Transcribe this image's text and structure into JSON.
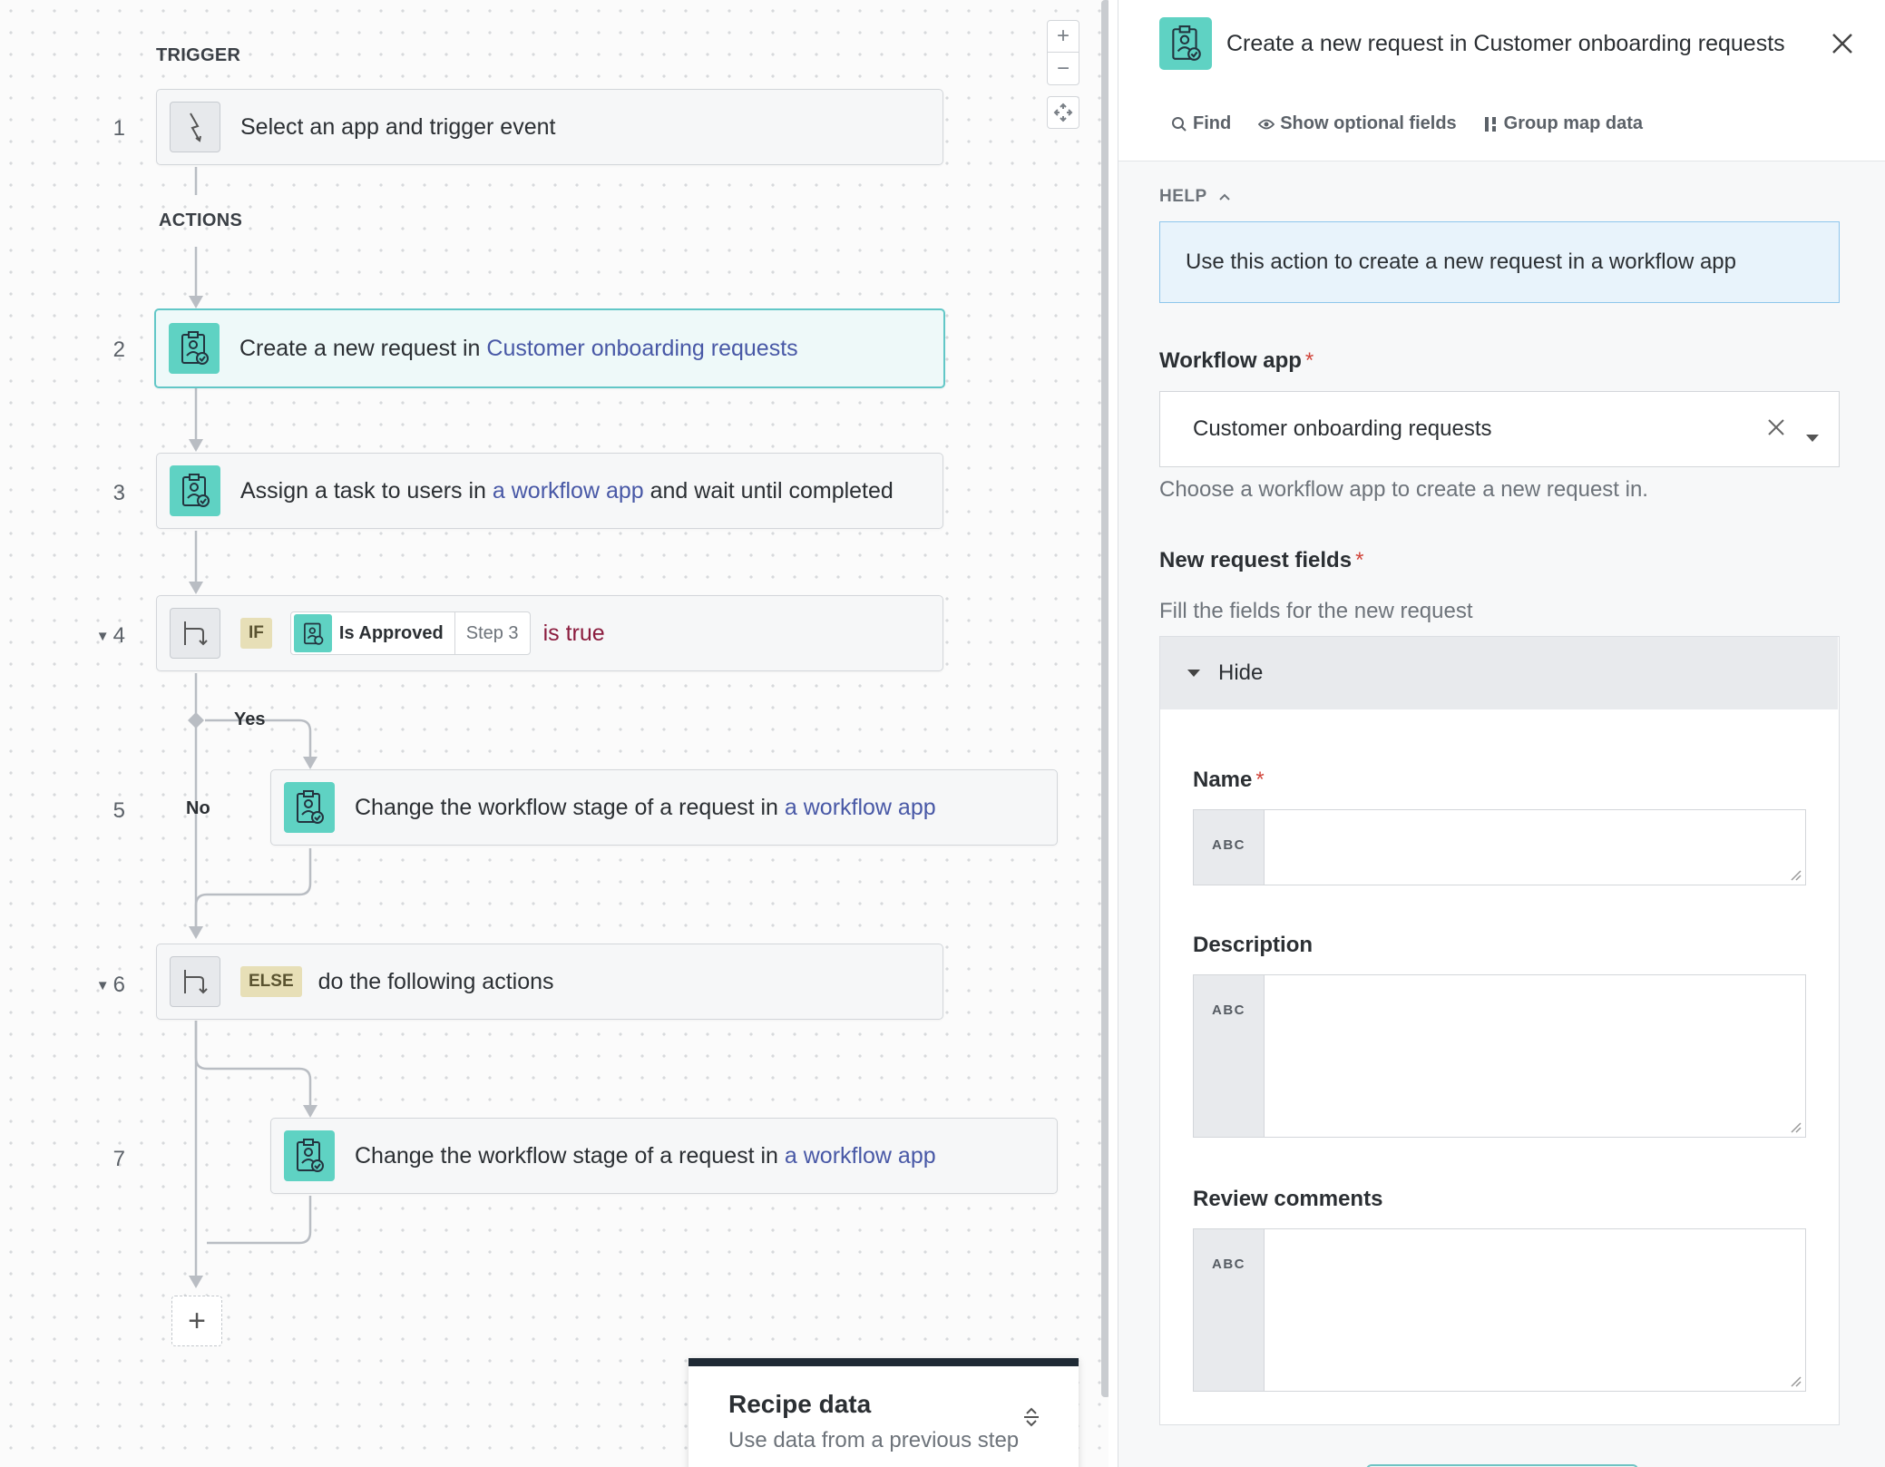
{
  "canvas": {
    "trigger_label": "TRIGGER",
    "actions_label": "ACTIONS",
    "steps": [
      {
        "num": "1",
        "text": "Select an app and trigger event"
      },
      {
        "num": "2",
        "text_prefix": "Create a new request in ",
        "link": "Customer onboarding requests"
      },
      {
        "num": "3",
        "text_prefix": "Assign a task to users in ",
        "link": "a workflow app",
        "text_suffix": " and wait until completed"
      },
      {
        "num": "4",
        "tag": "IF",
        "pill_main": "Is Approved",
        "pill_step": "Step 3",
        "condition": "is true"
      },
      {
        "num": "5",
        "text_prefix": "Change the workflow stage of a request in ",
        "link": "a workflow app"
      },
      {
        "num": "6",
        "tag": "ELSE",
        "text": "do the following actions"
      },
      {
        "num": "7",
        "text_prefix": "Change the workflow stage of a request in ",
        "link": "a workflow app"
      }
    ],
    "branch_yes": "Yes",
    "branch_no": "No",
    "add_step_symbol": "+",
    "zoom_in": "+",
    "zoom_out": "−",
    "recipe_data": {
      "title": "Recipe data",
      "subtitle": "Use data from a previous step"
    }
  },
  "panel": {
    "title_prefix": "Create a new request in ",
    "title_link": "Customer onboarding requests",
    "toolbar": {
      "find": "Find",
      "optional": "Show optional fields",
      "group": "Group map data"
    },
    "help_label": "HELP",
    "help_text": "Use this action to create a new request in a workflow app",
    "workflow_app_label": "Workflow app",
    "workflow_app_value": "Customer onboarding requests",
    "workflow_app_hint": "Choose a workflow app to create a new request in.",
    "new_fields_label": "New request fields",
    "new_fields_hint": "Fill the fields for the new request",
    "hide_label": "Hide",
    "fields": [
      {
        "label": "Name",
        "required": true,
        "type": "ABC"
      },
      {
        "label": "Description",
        "required": false,
        "type": "ABC"
      },
      {
        "label": "Review comments",
        "required": false,
        "type": "ABC"
      }
    ],
    "required_mark": "*"
  },
  "colors": {
    "accent_teal": "#5fd2c3",
    "link": "#4858a6",
    "condition": "#8b1c3e",
    "required": "#d1453b",
    "help_bg": "#e8f3fb"
  }
}
